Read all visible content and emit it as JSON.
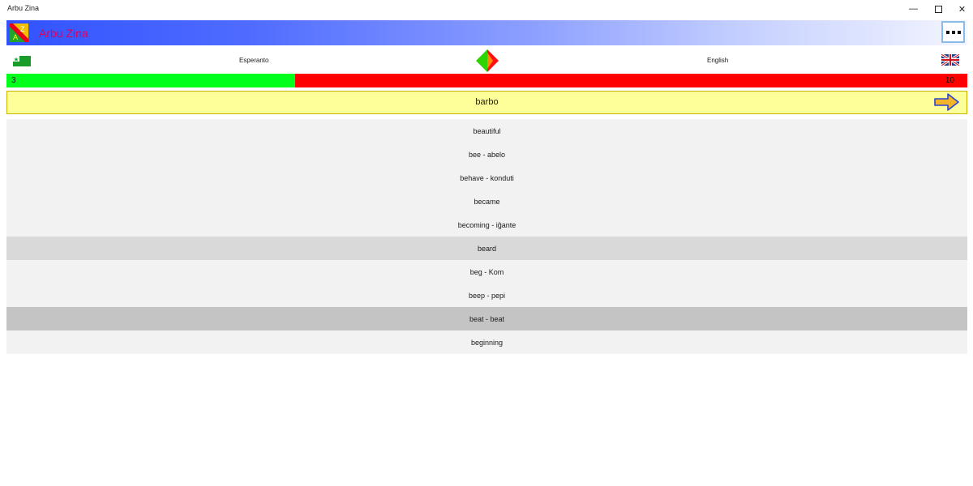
{
  "window": {
    "title": "Arbu Zina",
    "minimize_glyph": "—",
    "close_glyph": "✕"
  },
  "header": {
    "app_name": "Arbu Zina",
    "logo_letters": [
      "A",
      "Z"
    ],
    "more_icon": "more-icon",
    "gradient_colors": [
      "#3153ff",
      "#f3f5ff"
    ],
    "app_name_color": "#e0005a"
  },
  "languages": {
    "source": "Esperanto",
    "target": "English",
    "source_flag": "esperanto-flag-icon",
    "target_flag": "uk-flag-icon",
    "swap_icon": "swap-direction-icon"
  },
  "progress": {
    "correct": "3",
    "total": "10",
    "fraction": 0.3,
    "correct_color": "#00ff1a",
    "remaining_color": "#ff0000"
  },
  "question": {
    "word": "barbo",
    "next_icon": "arrow-right-icon"
  },
  "answers": [
    "beautiful",
    "bee - abelo",
    "behave - konduti",
    "became",
    "becoming - iĝante",
    "beard",
    "beg - Kom",
    "beep - pepi",
    "beat - beat",
    "beginning"
  ]
}
